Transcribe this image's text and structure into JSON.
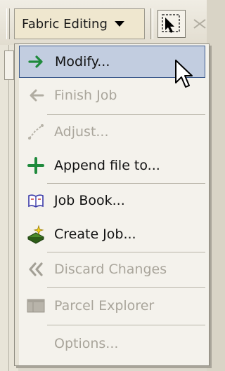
{
  "toolbar": {
    "dropdown_label": "Fabric Editing",
    "dropdown_icon": "chevron-down-icon",
    "tool_icon": "select-arrow-icon"
  },
  "menu": {
    "items": [
      {
        "label": "Modify...",
        "icon": "arrow-right-icon",
        "enabled": true,
        "highlighted": true
      },
      {
        "label": "Finish Job",
        "icon": "arrow-left-icon",
        "enabled": false
      },
      {
        "label": "Adjust...",
        "icon": "adjust-icon",
        "enabled": false
      },
      {
        "label": "Append file to...",
        "icon": "plus-icon",
        "enabled": true
      },
      {
        "label": "Job Book...",
        "icon": "job-book-icon",
        "enabled": true
      },
      {
        "label": "Create Job...",
        "icon": "create-job-icon",
        "enabled": true
      },
      {
        "label": "Discard Changes",
        "icon": "double-chevron-left-icon",
        "enabled": false
      },
      {
        "label": "Parcel Explorer",
        "icon": "parcel-explorer-icon",
        "enabled": false
      },
      {
        "label": "Options...",
        "icon": "",
        "enabled": false
      }
    ]
  },
  "colors": {
    "highlight": "#c2cde0",
    "green": "#1f8a3c",
    "disabled_text": "#a9a59b"
  }
}
